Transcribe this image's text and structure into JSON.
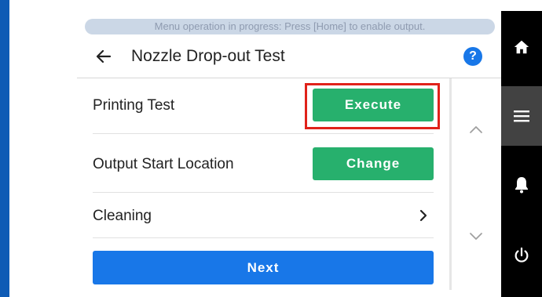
{
  "status_banner": "Menu operation in progress: Press [Home] to enable output.",
  "header": {
    "title": "Nozzle Drop-out Test",
    "help_icon": "question-icon",
    "help_text": "?"
  },
  "rows": [
    {
      "label": "Printing Test",
      "button": "Execute"
    },
    {
      "label": "Output Start Location",
      "button": "Change"
    },
    {
      "label": "Cleaning"
    }
  ],
  "next_label": "Next",
  "sidebar": {
    "icons": [
      "home-icon",
      "menu-icon",
      "bell-icon",
      "power-icon"
    ],
    "active": "menu-icon"
  },
  "colors": {
    "accent_green": "#27b06d",
    "accent_blue": "#1877e8",
    "highlight_red": "#e0221a",
    "sidebar_bg": "#000000"
  }
}
